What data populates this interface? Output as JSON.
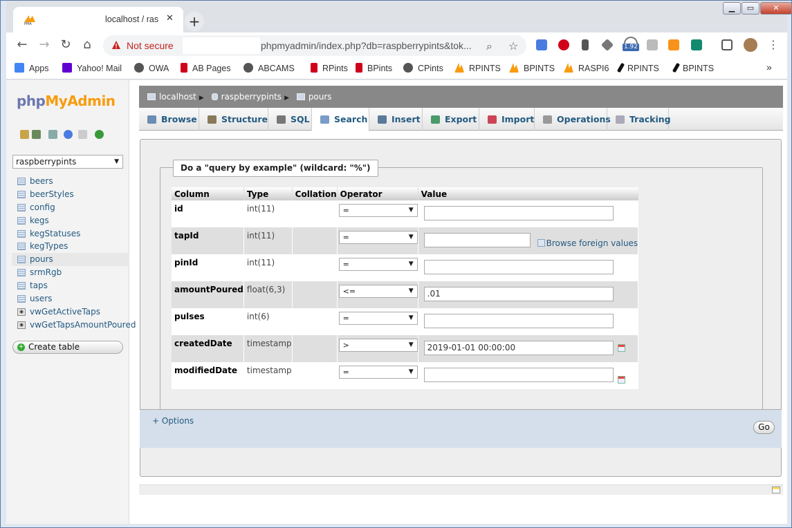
{
  "browser": {
    "tab_title": "localhost / ras",
    "tab_close": "✕",
    "new_tab": "+",
    "window_controls": {
      "minimize": "▁",
      "maximize": "▭",
      "close": "✕"
    },
    "security_label": "Not secure",
    "url": "phpmyadmin/index.php?db=raspberrypints&tok...",
    "icons": [
      "back-icon",
      "forward-icon",
      "reload-icon",
      "home-icon",
      "warning-icon",
      "zoom-icon",
      "star-icon",
      "translate-icon",
      "stop-icon",
      "bookmark-icon",
      "drive-icon",
      "speed-icon",
      "robin-icon",
      "rss-icon",
      "script-icon",
      "cast-icon",
      "profile-icon",
      "menu-icon"
    ],
    "speed_badge": "1.92",
    "bookmarks": [
      {
        "label": "Apps",
        "icon": "apps-icon",
        "color": "#4285f4"
      },
      {
        "label": "Yahoo! Mail",
        "icon": "yahoo-icon",
        "color": "#6001d2"
      },
      {
        "label": "OWA",
        "icon": "globe-icon",
        "color": "#555555"
      },
      {
        "label": "AB Pages",
        "icon": "cup-icon",
        "color": "#d0021b"
      },
      {
        "label": "ABCAMS",
        "icon": "globe-icon",
        "color": "#555555"
      },
      {
        "label": "RPints",
        "icon": "cup-icon",
        "color": "#d0021b"
      },
      {
        "label": "BPints",
        "icon": "cup-icon",
        "color": "#d0021b"
      },
      {
        "label": "CPints",
        "icon": "globe-icon",
        "color": "#555555"
      },
      {
        "label": "RPINTS",
        "icon": "pma-icon",
        "color": "#f89c0e"
      },
      {
        "label": "BPINTS",
        "icon": "pma-icon",
        "color": "#f89c0e"
      },
      {
        "label": "RASPI6",
        "icon": "pma-icon",
        "color": "#f89c0e"
      },
      {
        "label": "RPINTS",
        "icon": "feather-icon",
        "color": "#111111"
      },
      {
        "label": "BPINTS",
        "icon": "feather-icon",
        "color": "#111111"
      }
    ],
    "bookmarks_more": "»"
  },
  "nav": {
    "logo_php": "php",
    "logo_myadmin": "MyAdmin",
    "db_selected": "raspberrypints",
    "tables": [
      {
        "name": "beers",
        "kind": "table",
        "selected": false
      },
      {
        "name": "beerStyles",
        "kind": "table",
        "selected": false
      },
      {
        "name": "config",
        "kind": "table",
        "selected": false
      },
      {
        "name": "kegs",
        "kind": "table",
        "selected": false
      },
      {
        "name": "kegStatuses",
        "kind": "table",
        "selected": false
      },
      {
        "name": "kegTypes",
        "kind": "table",
        "selected": false
      },
      {
        "name": "pours",
        "kind": "table",
        "selected": true
      },
      {
        "name": "srmRgb",
        "kind": "table",
        "selected": false
      },
      {
        "name": "taps",
        "kind": "table",
        "selected": false
      },
      {
        "name": "users",
        "kind": "table",
        "selected": false
      },
      {
        "name": "vwGetActiveTaps",
        "kind": "view",
        "selected": false
      },
      {
        "name": "vwGetTapsAmountPoured",
        "kind": "view",
        "selected": false
      }
    ],
    "create_table": "Create table"
  },
  "breadcrumb": {
    "server": "localhost",
    "database": "raspberrypints",
    "table": "pours"
  },
  "tabs": [
    {
      "label": "Browse",
      "icon": "browse-icon",
      "active": false
    },
    {
      "label": "Structure",
      "icon": "structure-icon",
      "active": false
    },
    {
      "label": "SQL",
      "icon": "sql-icon",
      "active": false
    },
    {
      "label": "Search",
      "icon": "search-icon",
      "active": true
    },
    {
      "label": "Insert",
      "icon": "insert-icon",
      "active": false
    },
    {
      "label": "Export",
      "icon": "export-icon",
      "active": false
    },
    {
      "label": "Import",
      "icon": "import-icon",
      "active": false
    },
    {
      "label": "Operations",
      "icon": "operations-icon",
      "active": false
    },
    {
      "label": "Tracking",
      "icon": "tracking-icon",
      "active": false
    }
  ],
  "search": {
    "legend": "Do a \"query by example\" (wildcard: \"%\")",
    "headers": {
      "column": "Column",
      "type": "Type",
      "collation": "Collation",
      "operator": "Operator",
      "value": "Value"
    },
    "rows": [
      {
        "column": "id",
        "type": "int(11)",
        "operator": "=",
        "value": "",
        "extra": ""
      },
      {
        "column": "tapId",
        "type": "int(11)",
        "operator": "=",
        "value": "",
        "extra": "browse"
      },
      {
        "column": "pinId",
        "type": "int(11)",
        "operator": "=",
        "value": "",
        "extra": ""
      },
      {
        "column": "amountPoured",
        "type": "float(6,3)",
        "operator": "<=",
        "value": ".01",
        "extra": ""
      },
      {
        "column": "pulses",
        "type": "int(6)",
        "operator": "=",
        "value": "",
        "extra": ""
      },
      {
        "column": "createdDate",
        "type": "timestamp",
        "operator": ">",
        "value": "2019-01-01 00:00:00",
        "extra": "calendar"
      },
      {
        "column": "modifiedDate",
        "type": "timestamp",
        "operator": "=",
        "value": "",
        "extra": "calendar"
      }
    ],
    "browse_foreign": "Browse foreign values",
    "options": "+ Options",
    "go": "Go"
  }
}
